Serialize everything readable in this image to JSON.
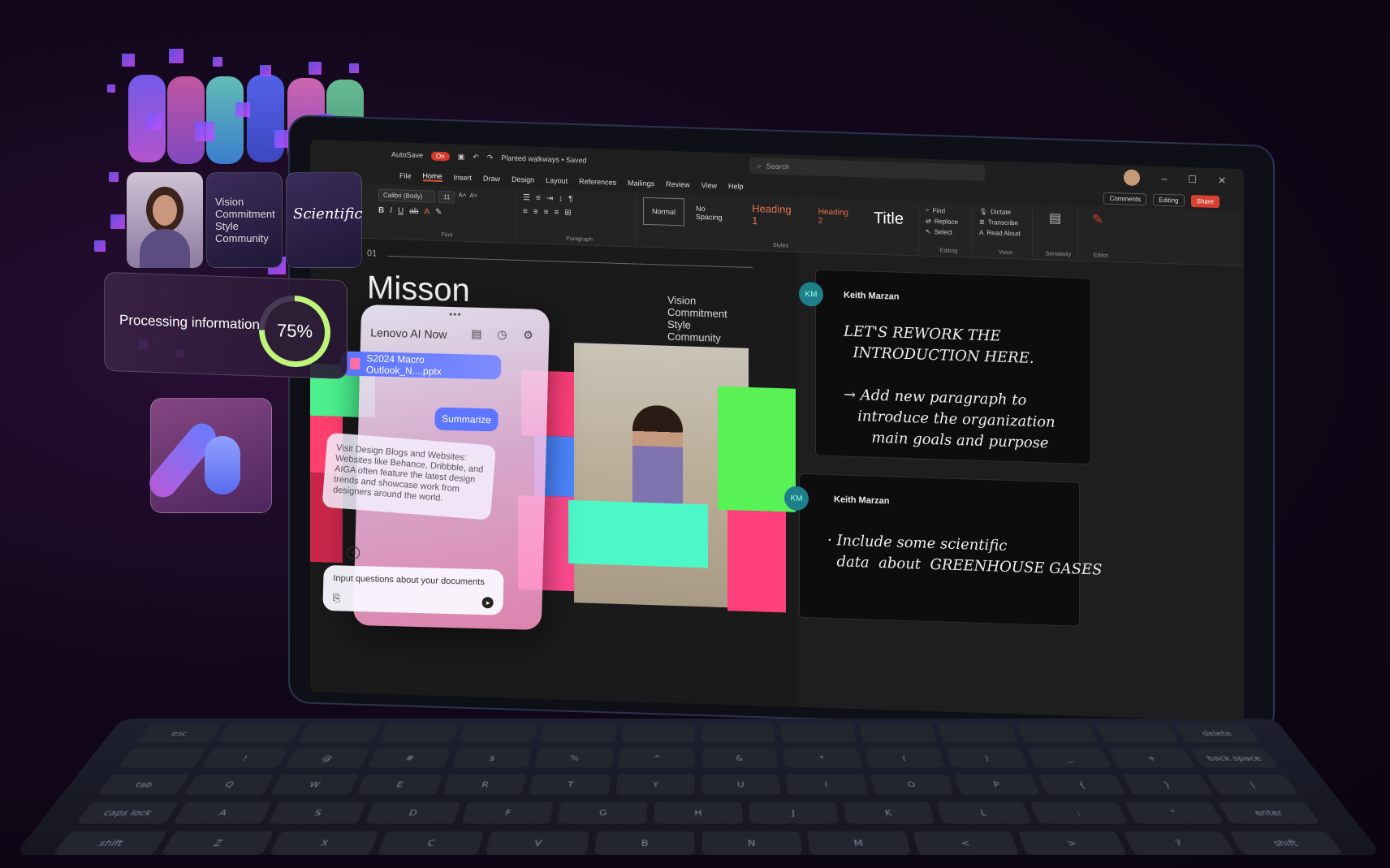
{
  "window": {
    "autosave_label": "AutoSave",
    "autosave_state": "On",
    "document_title": "Planted walkways • Saved",
    "search_placeholder": "Search"
  },
  "ribbon_tabs": [
    "File",
    "Home",
    "Insert",
    "Draw",
    "Design",
    "Layout",
    "References",
    "Mailings",
    "Review",
    "View",
    "Help"
  ],
  "ribbon_right": {
    "comments": "Comments",
    "editing": "Editing",
    "share": "Share"
  },
  "ribbon": {
    "font_name": "Calibri (Body)",
    "font_size": "11",
    "font_group": "Font",
    "paragraph_group": "Paragraph",
    "styles_group": "Styles",
    "styles": [
      "Normal",
      "No Spacing",
      "Heading 1",
      "Heading 2",
      "Title"
    ],
    "editing_tools": [
      "Find",
      "Replace",
      "Select"
    ],
    "editing_group": "Editing",
    "voice_tools": [
      "Dictate",
      "Transcribe",
      "Read Aloud"
    ],
    "voice_group": "Voice",
    "sensitivity": "Sensitivity",
    "editor": "Editor"
  },
  "slide": {
    "number": "01",
    "title": "Misson",
    "list": [
      "Vision",
      "Commitment",
      "Style",
      "Community"
    ]
  },
  "comments": [
    {
      "initials": "KM",
      "author": "Keith Marzan",
      "text": "LET'S REWORK THE\n  INTRODUCTION HERE.\n\n→ Add new paragraph to\n   introduce the organization\n      main goals and purpose"
    },
    {
      "initials": "KM",
      "author": "Keith Marzan",
      "text": "· Include some scientific\n  data  about  GREENHOUSE GASES"
    }
  ],
  "ai_panel": {
    "title": "Lenovo AI Now",
    "file_name": "S2024 Macro Outlook_N....pptx",
    "summarize": "Summarize",
    "response": "Visit Design Blogs and Websites: Websites like Behance, Dribbble, and AIGA often feature the latest design trends and showcase work from designers around the world.",
    "input_placeholder": "Input questions about your documents"
  },
  "cards": {
    "tile_text": [
      "Vision",
      "Commitment",
      "Style",
      "Community"
    ],
    "tile_scientific": "Scientific",
    "processing_label": "Processing information",
    "processing_percent": "75%",
    "processing_progress": 0.75
  },
  "keyboard": {
    "row1": [
      "esc",
      "",
      "",
      "",
      "",
      "",
      "",
      "",
      "",
      "",
      "",
      "",
      "",
      "delete"
    ],
    "row2": [
      "",
      "!",
      "@",
      "#",
      "$",
      "%",
      "^",
      "&",
      "*",
      "(",
      ")",
      "_",
      "+",
      "back space"
    ],
    "row3": [
      "tab",
      "Q",
      "W",
      "E",
      "R",
      "T",
      "Y",
      "U",
      "I",
      "O",
      "P",
      "{",
      "}",
      "|"
    ],
    "row4": [
      "caps lock",
      "A",
      "S",
      "D",
      "F",
      "G",
      "H",
      "J",
      "K",
      "L",
      ":",
      "\"",
      "enter"
    ],
    "row5": [
      "shift",
      "Z",
      "X",
      "C",
      "V",
      "B",
      "N",
      "M",
      "<",
      ">",
      "?",
      "shift"
    ]
  },
  "colors": {
    "accent_red": "#d7412f",
    "ai_blue": "#5c76ff",
    "ring_green": "#bdf57a"
  }
}
